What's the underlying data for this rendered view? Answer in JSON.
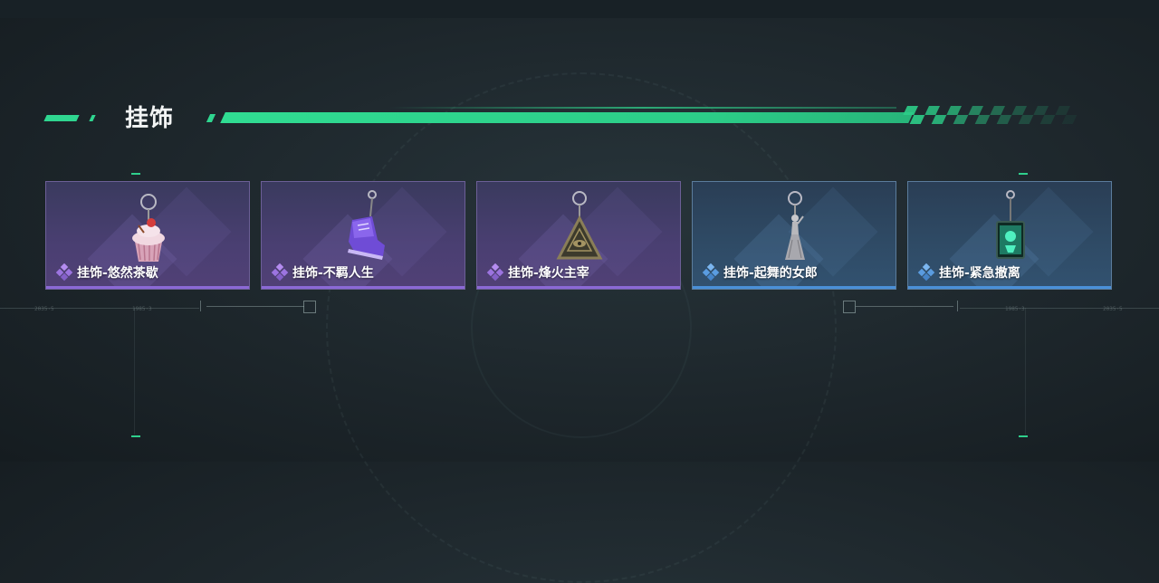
{
  "section": {
    "title": "挂饰"
  },
  "items": [
    {
      "label": "挂饰-悠然茶歇",
      "rarity": "purple",
      "icon": "cupcake-charm-icon"
    },
    {
      "label": "挂饰-不羁人生",
      "rarity": "purple",
      "icon": "sneaker-charm-icon"
    },
    {
      "label": "挂饰-烽火主宰",
      "rarity": "purple",
      "icon": "pyramid-charm-icon"
    },
    {
      "label": "挂饰-起舞的女郎",
      "rarity": "blue",
      "icon": "dancer-charm-icon"
    },
    {
      "label": "挂饰-紧急撤离",
      "rarity": "blue",
      "icon": "emergency-box-charm-icon"
    }
  ],
  "colors": {
    "accent": "#2fd690",
    "purple": "#8b69d6",
    "blue": "#4a90d8"
  }
}
